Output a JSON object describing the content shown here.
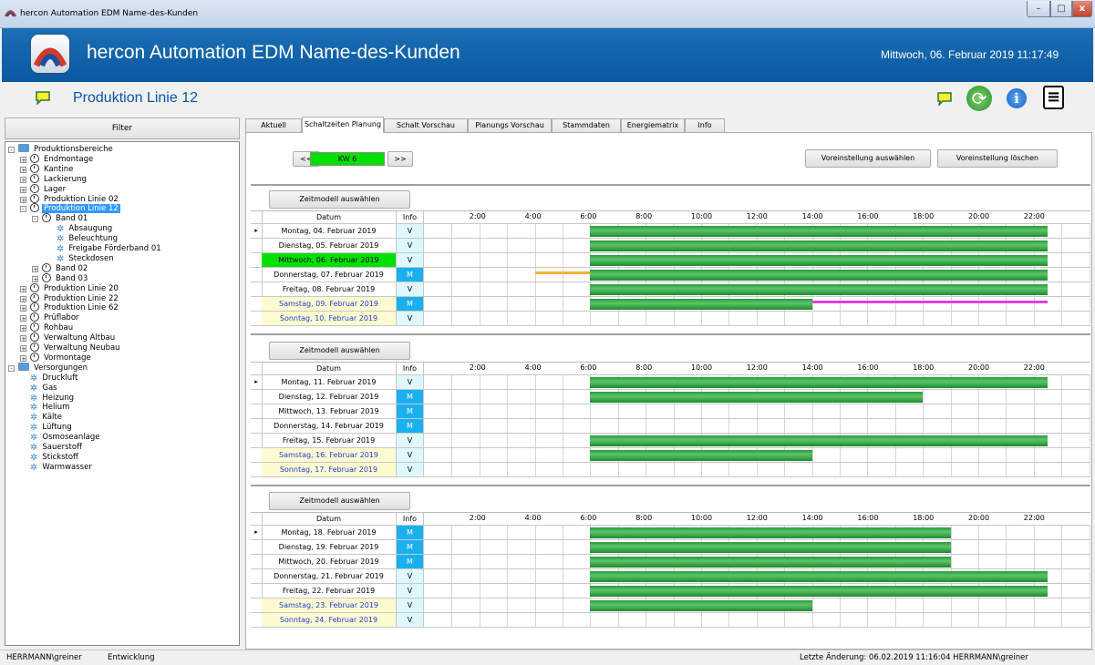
{
  "window": {
    "title": "hercon Automation EDM   Name-des-Kunden",
    "min": "–",
    "max": "□",
    "close": "x"
  },
  "header": {
    "app_title": "hercon Automation EDM   Name-des-Kunden",
    "datetime": "Mittwoch, 06. Februar 2019   11:17:49"
  },
  "subheader": {
    "page_title": "Produktion Linie 12",
    "menu_icon": "≡",
    "info_icon": "i",
    "refresh_icon": "⟳"
  },
  "sidebar": {
    "filter_label": "Filter",
    "tree": [
      {
        "label": "Produktionsbereiche",
        "level": 0,
        "kind": "folder",
        "pm": "-"
      },
      {
        "label": "Endmontage",
        "level": 1,
        "kind": "clock",
        "pm": "+"
      },
      {
        "label": "Kantine",
        "level": 1,
        "kind": "clock",
        "pm": "+"
      },
      {
        "label": "Lackierung",
        "level": 1,
        "kind": "clock",
        "pm": "+"
      },
      {
        "label": "Lager",
        "level": 1,
        "kind": "clock",
        "pm": "+"
      },
      {
        "label": "Produktion Linie 02",
        "level": 1,
        "kind": "clock",
        "pm": "+"
      },
      {
        "label": "Produktion Linie 12",
        "level": 1,
        "kind": "clock",
        "pm": "-",
        "selected": true
      },
      {
        "label": "Band 01",
        "level": 2,
        "kind": "clock",
        "pm": "-"
      },
      {
        "label": "Absaugung",
        "level": 3,
        "kind": "gear"
      },
      {
        "label": "Beleuchtung",
        "level": 3,
        "kind": "gear"
      },
      {
        "label": "Freigabe Förderband 01",
        "level": 3,
        "kind": "gear"
      },
      {
        "label": "Steckdosen",
        "level": 3,
        "kind": "gear"
      },
      {
        "label": "Band 02",
        "level": 2,
        "kind": "clock",
        "pm": "+"
      },
      {
        "label": "Band 03",
        "level": 2,
        "kind": "clock",
        "pm": "+"
      },
      {
        "label": "Produktion Linie 20",
        "level": 1,
        "kind": "clock",
        "pm": "+"
      },
      {
        "label": "Produktion Linie 22",
        "level": 1,
        "kind": "clock",
        "pm": "+"
      },
      {
        "label": "Produktion Linie 62",
        "level": 1,
        "kind": "clock",
        "pm": "+"
      },
      {
        "label": "Prüflabor",
        "level": 1,
        "kind": "clock",
        "pm": "+"
      },
      {
        "label": "Rohbau",
        "level": 1,
        "kind": "clock",
        "pm": "+"
      },
      {
        "label": "Verwaltung Altbau",
        "level": 1,
        "kind": "clock",
        "pm": "+"
      },
      {
        "label": "Verwaltung Neubau",
        "level": 1,
        "kind": "clock",
        "pm": "+"
      },
      {
        "label": "Vormontage",
        "level": 1,
        "kind": "clock",
        "pm": "+"
      },
      {
        "label": "Versorgungen",
        "level": 0,
        "kind": "folder",
        "pm": "-"
      },
      {
        "label": "Druckluft",
        "level": 1,
        "kind": "gear"
      },
      {
        "label": "Gas",
        "level": 1,
        "kind": "gear"
      },
      {
        "label": "Heizung",
        "level": 1,
        "kind": "gear"
      },
      {
        "label": "Helium",
        "level": 1,
        "kind": "gear"
      },
      {
        "label": "Kälte",
        "level": 1,
        "kind": "gear"
      },
      {
        "label": "Lüftung",
        "level": 1,
        "kind": "gear"
      },
      {
        "label": "Osmoseanlage",
        "level": 1,
        "kind": "gear"
      },
      {
        "label": "Sauerstoff",
        "level": 1,
        "kind": "gear"
      },
      {
        "label": "Stickstoff",
        "level": 1,
        "kind": "gear"
      },
      {
        "label": "Warmwasser",
        "level": 1,
        "kind": "gear"
      }
    ]
  },
  "tabs": [
    {
      "label": "Aktuell"
    },
    {
      "label": "Schaltzeiten Planung",
      "active": true
    },
    {
      "label": "Schalt Vorschau"
    },
    {
      "label": "Planungs Vorschau"
    },
    {
      "label": "Stammdaten"
    },
    {
      "label": "Energiematrix"
    },
    {
      "label": "Info"
    }
  ],
  "controls": {
    "prev": "<<",
    "next": ">>",
    "week": "KW 6",
    "select_preset": "Voreinstellung auswählen",
    "delete_preset": "Voreinstellung löschen",
    "select_timemodel": "Zeitmodell auswählen"
  },
  "grid_header": {
    "datum": "Datum",
    "info": "Info",
    "hours": [
      "2:00",
      "4:00",
      "6:00",
      "8:00",
      "10:00",
      "12:00",
      "14:00",
      "16:00",
      "18:00",
      "20:00",
      "22:00"
    ]
  },
  "colors": {
    "green": "#2b9b3a",
    "orange": "#f5b13a",
    "magenta": "#e040e0",
    "today": "#00e000",
    "weekend": "#fffbd0",
    "weekday_info_v": "#dff7ff",
    "info_m": "#1ab0f0",
    "blue_text": "#1a3fd8"
  },
  "weeks": [
    {
      "rows": [
        {
          "date": "Montag, 04. Februar 2019",
          "info": "V",
          "cursor": true,
          "bars": [
            {
              "start": 6,
              "end": 22.5,
              "color": "green"
            }
          ]
        },
        {
          "date": "Dienstag, 05. Februar 2019",
          "info": "V",
          "bars": [
            {
              "start": 6,
              "end": 22.5,
              "color": "green"
            }
          ]
        },
        {
          "date": "Mittwoch, 06. Februar 2019",
          "info": "V",
          "today": true,
          "bars": [
            {
              "start": 6,
              "end": 22.5,
              "color": "green"
            }
          ]
        },
        {
          "date": "Donnerstag, 07. Februar 2019",
          "info": "M",
          "bars": [
            {
              "start": 4,
              "end": 6,
              "color": "orange",
              "thin": true
            },
            {
              "start": 6,
              "end": 22.5,
              "color": "green"
            }
          ]
        },
        {
          "date": "Freitag, 08. Februar 2019",
          "info": "V",
          "bars": [
            {
              "start": 6,
              "end": 22.5,
              "color": "green"
            }
          ]
        },
        {
          "date": "Samstag, 09. Februar 2019",
          "info": "M",
          "weekend": true,
          "bars": [
            {
              "start": 6,
              "end": 14,
              "color": "green"
            },
            {
              "start": 14,
              "end": 22.5,
              "color": "magenta",
              "thin": true
            }
          ]
        },
        {
          "date": "Sonntag, 10. Februar 2019",
          "info": "V",
          "weekend": true,
          "bars": []
        }
      ]
    },
    {
      "rows": [
        {
          "date": "Montag, 11. Februar 2019",
          "info": "V",
          "cursor": true,
          "bars": [
            {
              "start": 6,
              "end": 22.5,
              "color": "green"
            }
          ]
        },
        {
          "date": "Dienstag, 12. Februar 2019",
          "info": "M",
          "bars": [
            {
              "start": 6,
              "end": 18,
              "color": "green"
            }
          ]
        },
        {
          "date": "Mittwoch, 13. Februar 2019",
          "info": "M",
          "bars": []
        },
        {
          "date": "Donnerstag, 14. Februar 2019",
          "info": "M",
          "bars": []
        },
        {
          "date": "Freitag, 15. Februar 2019",
          "info": "V",
          "bars": [
            {
              "start": 6,
              "end": 22.5,
              "color": "green"
            }
          ]
        },
        {
          "date": "Samstag, 16. Februar 2019",
          "info": "V",
          "weekend": true,
          "bars": [
            {
              "start": 6,
              "end": 14,
              "color": "green"
            }
          ]
        },
        {
          "date": "Sonntag, 17. Februar 2019",
          "info": "V",
          "weekend": true,
          "bars": []
        }
      ]
    },
    {
      "rows": [
        {
          "date": "Montag, 18. Februar 2019",
          "info": "M",
          "cursor": true,
          "bars": [
            {
              "start": 6,
              "end": 19,
              "color": "green"
            }
          ]
        },
        {
          "date": "Dienstag, 19. Februar 2019",
          "info": "M",
          "bars": [
            {
              "start": 6,
              "end": 19,
              "color": "green"
            }
          ]
        },
        {
          "date": "Mittwoch, 20. Februar 2019",
          "info": "M",
          "bars": [
            {
              "start": 6,
              "end": 19,
              "color": "green"
            }
          ]
        },
        {
          "date": "Donnerstag, 21. Februar 2019",
          "info": "V",
          "bars": [
            {
              "start": 6,
              "end": 22.5,
              "color": "green"
            }
          ]
        },
        {
          "date": "Freitag, 22. Februar 2019",
          "info": "V",
          "bars": [
            {
              "start": 6,
              "end": 22.5,
              "color": "green"
            }
          ]
        },
        {
          "date": "Samstag, 23. Februar 2019",
          "info": "V",
          "weekend": true,
          "bars": [
            {
              "start": 6,
              "end": 14,
              "color": "green"
            }
          ]
        },
        {
          "date": "Sonntag, 24. Februar 2019",
          "info": "V",
          "weekend": true,
          "bars": []
        }
      ]
    }
  ],
  "status": {
    "user": "HERRMANN\\greiner",
    "env": "Entwicklung",
    "last_change": "Letzte Änderung:  06.02.2019 11:16:04  HERRMANN\\greiner"
  }
}
